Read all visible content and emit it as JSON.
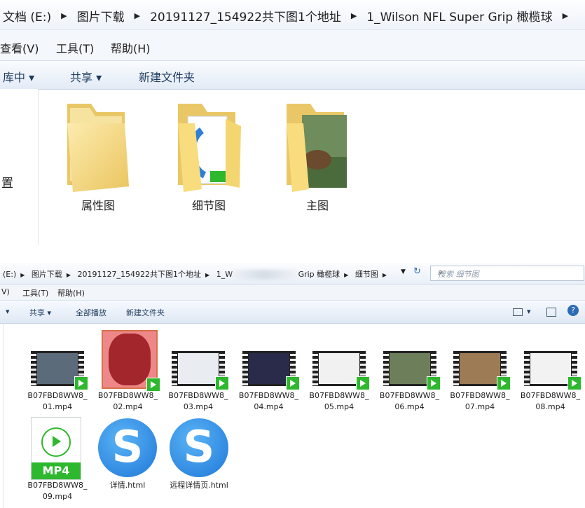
{
  "top_window": {
    "crumbs": [
      "文档 (E:)",
      "图片下载",
      "20191127_154922共下图1个地址",
      "1_Wilson NFL Super Grip 橄榄球"
    ],
    "menu": [
      "查看(V)",
      "工具(T)",
      "帮助(H)"
    ],
    "toolbar": {
      "library": "库中 ▾",
      "share": "共享 ▾",
      "new_folder": "新建文件夹"
    },
    "nav_label": "置",
    "folders": [
      {
        "name": "属性图",
        "kind": "plain"
      },
      {
        "name": "细节图",
        "kind": "detail"
      },
      {
        "name": "主图",
        "kind": "photo"
      }
    ]
  },
  "bottom_window": {
    "crumbs": [
      "(E:)",
      "图片下载",
      "20191127_154922共下图1个地址",
      "1_W",
      "Grip 橄榄球",
      "细节图"
    ],
    "search_placeholder": "搜索 细节图",
    "menu": [
      "V)",
      "工具(T)",
      "帮助(H)"
    ],
    "toolbar": {
      "share": "共享 ▾",
      "play_all": "全部播放",
      "new_folder": "新建文件夹"
    },
    "files": [
      {
        "name": [
          "B07FBD8WW8_",
          "01.mp4"
        ],
        "type": "video",
        "color": "#5b6b7a"
      },
      {
        "name": [
          "B07FBD8WW8_",
          "02.mp4"
        ],
        "type": "video",
        "color": "#8a2f2f"
      },
      {
        "name": [
          "B07FBD8WW8_",
          "03.mp4"
        ],
        "type": "video",
        "color": "#e9edf2"
      },
      {
        "name": [
          "B07FBD8WW8_",
          "04.mp4"
        ],
        "type": "video",
        "color": "#2a2b4a"
      },
      {
        "name": [
          "B07FBD8WW8_",
          "05.mp4"
        ],
        "type": "video",
        "color": "#f1f1f1"
      },
      {
        "name": [
          "B07FBD8WW8_",
          "06.mp4"
        ],
        "type": "video",
        "color": "#6d7f5a"
      },
      {
        "name": [
          "B07FBD8WW8_",
          "07.mp4"
        ],
        "type": "video",
        "color": "#9c7b55"
      },
      {
        "name": [
          "B07FBD8WW8_",
          "08.mp4"
        ],
        "type": "video",
        "color": "#f2f2f2"
      },
      {
        "name": [
          "B07FBD8WW8_",
          "09.mp4"
        ],
        "type": "mp4doc",
        "label": "MP4"
      },
      {
        "name": [
          "详情.html"
        ],
        "type": "html"
      },
      {
        "name": [
          "远程详情页.html"
        ],
        "type": "html"
      }
    ]
  }
}
